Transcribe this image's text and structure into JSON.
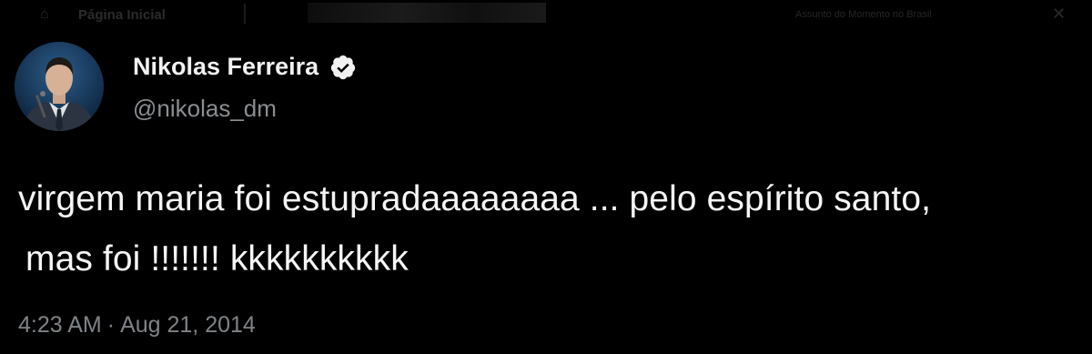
{
  "background_ui": {
    "home_label": "Página Inicial",
    "banner_text": "Assunto do Momento no Brasil",
    "home_icon": "home-icon",
    "close_icon": "close-icon"
  },
  "tweet": {
    "author_name": "Nikolas Ferreira",
    "author_handle": "@nikolas_dm",
    "verified": true,
    "text_line_1": "virgem maria foi estupradaaaaaaaa ... pelo espírito santo,",
    "text_line_2": "mas foi !!!!!!! kkkkkkkkkk",
    "time": "4:23 AM",
    "separator": "·",
    "date": "Aug 21, 2014"
  },
  "colors": {
    "background": "#000000",
    "text_primary": "#f5f5f5",
    "text_secondary": "#8a8d91",
    "verified_badge": "#f2f2f2"
  }
}
